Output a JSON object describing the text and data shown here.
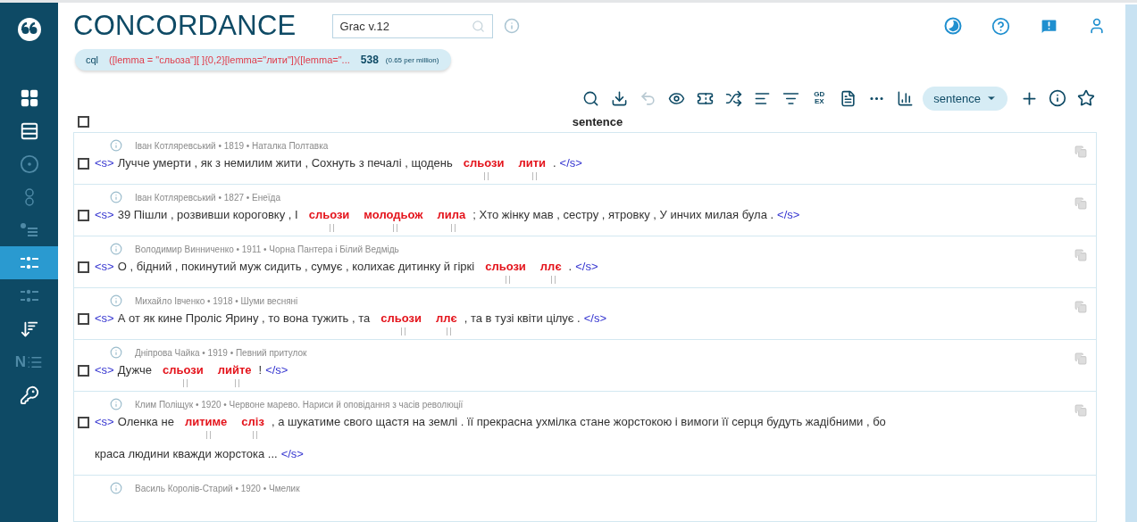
{
  "sidebar": {
    "items": [
      {
        "kind": "grid",
        "selected": false,
        "disabled": false
      },
      {
        "kind": "stack",
        "selected": false,
        "disabled": false
      },
      {
        "kind": "target",
        "selected": false,
        "disabled": true
      },
      {
        "kind": "rings",
        "selected": false,
        "disabled": true
      },
      {
        "kind": "bullets",
        "selected": false,
        "disabled": true
      },
      {
        "kind": "dots",
        "selected": true,
        "disabled": false
      },
      {
        "kind": "dots",
        "selected": false,
        "disabled": true
      },
      {
        "kind": "sort",
        "selected": false,
        "disabled": false
      },
      {
        "kind": "number",
        "label": "N",
        "selected": false,
        "disabled": true
      },
      {
        "kind": "key",
        "selected": false,
        "disabled": false
      }
    ]
  },
  "header": {
    "title": "CONCORDANCE",
    "search": {
      "value": "Grac v.12"
    }
  },
  "query": {
    "label": "cql",
    "text": "([lemma = \"сльоза\"][ ]{0,2}[lemma=\"лити\"])([lemma=\"...",
    "count": "538",
    "frequency": "(0.65 per million)"
  },
  "toolbar": {
    "items": [
      {
        "kind": "zoom",
        "disabled": false
      },
      {
        "kind": "download",
        "disabled": false
      },
      {
        "kind": "undo",
        "disabled": true
      },
      {
        "kind": "eye",
        "disabled": false
      },
      {
        "kind": "ticket",
        "disabled": false
      },
      {
        "kind": "shuffle",
        "disabled": false
      },
      {
        "kind": "sort",
        "disabled": false
      },
      {
        "kind": "filter",
        "disabled": false
      },
      {
        "kind": "gdex",
        "label": "GD EX",
        "disabled": false
      },
      {
        "kind": "doc",
        "disabled": false
      },
      {
        "kind": "dots",
        "disabled": false
      },
      {
        "kind": "chart",
        "disabled": false
      }
    ],
    "view_select": "sentence"
  },
  "table": {
    "column": "sentence",
    "select_all": {
      "checked": false
    },
    "rows": [
      {
        "meta": "Іван Котляревський • 1819 • Наталка Полтавка",
        "checked": false,
        "segments": [
          {
            "kind": "tag",
            "text": "<s>"
          },
          {
            "kind": "text",
            "text": "Лучче умерти , як з немилим жити , Сохнуть з печалі , щодень"
          },
          {
            "kind": "hit",
            "text": "сльози"
          },
          {
            "kind": "hit",
            "text": "лити"
          },
          {
            "kind": "text",
            "text": "."
          },
          {
            "kind": "tag",
            "text": "</s>"
          }
        ]
      },
      {
        "meta": "Іван Котляревський • 1827 • Енеїда",
        "checked": false,
        "segments": [
          {
            "kind": "tag",
            "text": "<s>"
          },
          {
            "kind": "text",
            "text": "39 Пішли , розвивши короговку , І"
          },
          {
            "kind": "hit",
            "text": "сльози"
          },
          {
            "kind": "hit",
            "text": "молодьож"
          },
          {
            "kind": "hit",
            "text": "лила"
          },
          {
            "kind": "text",
            "text": "; Хто жінку мав , сестру , ятровку , У инчих милая була ."
          },
          {
            "kind": "tag",
            "text": "</s>"
          }
        ]
      },
      {
        "meta": "Володимир Винниченко • 1911 • Чорна Пантера і Білий Ведмідь",
        "checked": false,
        "segments": [
          {
            "kind": "tag",
            "text": "<s>"
          },
          {
            "kind": "text",
            "text": "О , бідний , покинутий муж сидить , сумує , колихає дитинку й гіркі"
          },
          {
            "kind": "hit",
            "text": "сльози"
          },
          {
            "kind": "hit",
            "text": "ллє"
          },
          {
            "kind": "text",
            "text": "."
          },
          {
            "kind": "tag",
            "text": "</s>"
          }
        ]
      },
      {
        "meta": "Михайло Івченко • 1918 • Шуми весняні",
        "checked": false,
        "segments": [
          {
            "kind": "tag",
            "text": "<s>"
          },
          {
            "kind": "text",
            "text": "А от як кине Проліс Ярину , то вона тужить , та"
          },
          {
            "kind": "hit",
            "text": "сльози"
          },
          {
            "kind": "hit",
            "text": "ллє"
          },
          {
            "kind": "text",
            "text": ", та в тузі квіти цілує ."
          },
          {
            "kind": "tag",
            "text": "</s>"
          }
        ]
      },
      {
        "meta": "Дніпрова Чайка • 1919 • Певний притулок",
        "checked": false,
        "segments": [
          {
            "kind": "tag",
            "text": "<s>"
          },
          {
            "kind": "text",
            "text": "Дужче"
          },
          {
            "kind": "hit",
            "text": "сльози"
          },
          {
            "kind": "hit",
            "text": "лийте"
          },
          {
            "kind": "text",
            "text": "!"
          },
          {
            "kind": "tag",
            "text": "</s>"
          }
        ]
      },
      {
        "meta": "Клим Поліщук • 1920 • Червоне марево. Нариси й оповідання з часів революції",
        "checked": false,
        "segments": [
          {
            "kind": "tag",
            "text": "<s>"
          },
          {
            "kind": "text",
            "text": "Оленка не"
          },
          {
            "kind": "hit",
            "text": "литиме"
          },
          {
            "kind": "hit",
            "text": "сліз"
          },
          {
            "kind": "text",
            "text": ", а шукатиме свого щастя на землі . її прекрасна ухмілка стане жорстокою і вимоги її серця будуть жадібними , бо"
          },
          {
            "kind": "break"
          },
          {
            "kind": "text",
            "text": "краса людини кважди жорстока ..."
          },
          {
            "kind": "tag",
            "text": "</s>"
          }
        ]
      },
      {
        "meta": "Василь Королів-Старий • 1920 • Чмелик"
      }
    ]
  }
}
